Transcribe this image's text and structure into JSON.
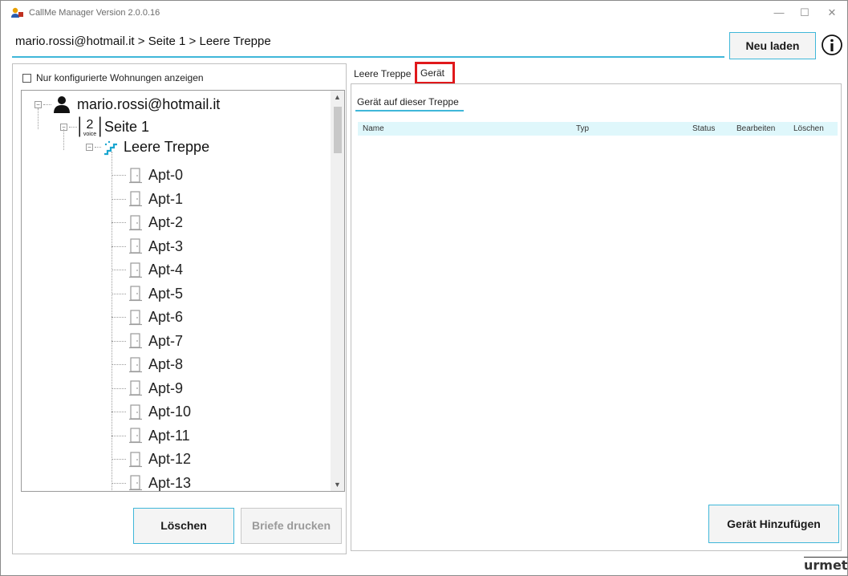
{
  "window": {
    "title": "CallMe Manager Version 2.0.0.16",
    "minimize": "—",
    "maximize": "☐",
    "close": "✕"
  },
  "header": {
    "breadcrumb": "mario.rossi@hotmail.it > Seite 1 > Leere Treppe",
    "reload_label": "Neu laden"
  },
  "left": {
    "checkbox_label": "Nur konfigurierte Wohnungen anzeigen",
    "tree": {
      "root": "mario.rossi@hotmail.it",
      "page": "Seite 1",
      "stair": "Leere Treppe",
      "apartments": [
        "Apt-0",
        "Apt-1",
        "Apt-2",
        "Apt-3",
        "Apt-4",
        "Apt-5",
        "Apt-6",
        "Apt-7",
        "Apt-8",
        "Apt-9",
        "Apt-10",
        "Apt-11",
        "Apt-12",
        "Apt-13"
      ]
    },
    "delete_label": "Löschen",
    "print_label": "Briefe drucken"
  },
  "right": {
    "tabs": [
      {
        "label": "Leere Treppe"
      },
      {
        "label": "Gerät"
      }
    ],
    "section_title": "Gerät auf dieser Treppe",
    "columns": [
      "Name",
      "Typ",
      "Status",
      "Bearbeiten",
      "Löschen"
    ],
    "add_label": "Gerät Hinzufügen"
  },
  "brand": {
    "logo_text": "urmet"
  },
  "colors": {
    "accent": "#3fb7d9",
    "highlight": "#e0181b",
    "header_bg": "#dff7fb"
  }
}
